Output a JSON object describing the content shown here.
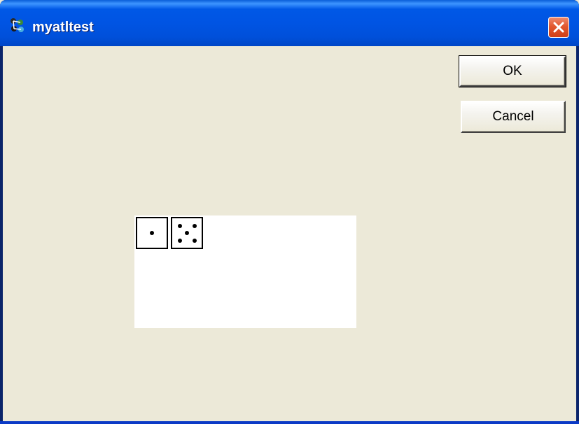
{
  "window": {
    "title": "myatltest",
    "icon": "atl-app-icon",
    "close_icon": "close-icon"
  },
  "buttons": {
    "ok_label": "OK",
    "cancel_label": "Cancel"
  },
  "dice": [
    {
      "value": 1
    },
    {
      "value": 5
    }
  ],
  "colors": {
    "titlebar": "#0054e3",
    "dialog_background": "#ece9d8",
    "close_button": "#e2582f",
    "canvas_background": "#ffffff"
  }
}
